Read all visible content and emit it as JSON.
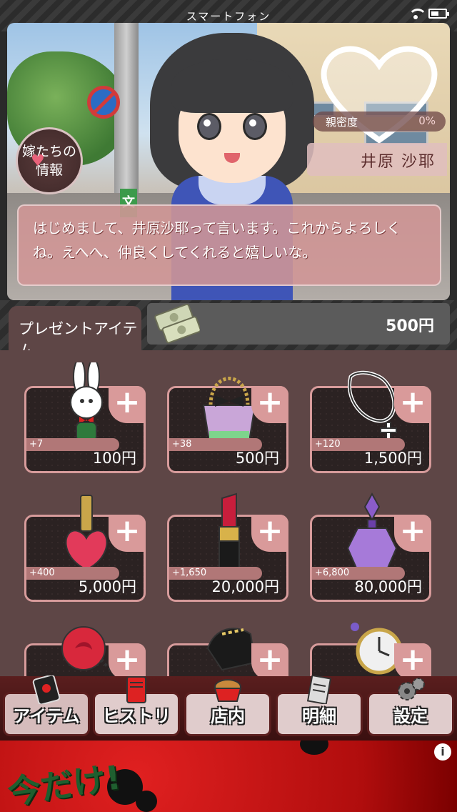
{
  "status_bar": {
    "title": "スマートフォン"
  },
  "scene": {
    "affection_label": "親密度",
    "affection_value": "0%",
    "character_name": "井原 沙耶",
    "info_button": {
      "line1": "嫁たちの",
      "line2": "情報"
    },
    "school_sign": "文",
    "dialog": "はじめまして、井原沙耶って言います。これからよろしくね。えへへ、仲良くしてくれると嬉しいな。"
  },
  "present": {
    "tab_label": "プレゼントアイテム",
    "money": "500円"
  },
  "items": [
    {
      "icon": "bunny-doll-icon",
      "affinity": "+7",
      "affinity_level": 0.55,
      "price": "100円"
    },
    {
      "icon": "handbag-icon",
      "affinity": "+38",
      "affinity_level": 0.55,
      "price": "500円"
    },
    {
      "icon": "necklace-icon",
      "affinity": "+120",
      "affinity_level": 0.55,
      "price": "1,500円"
    },
    {
      "icon": "nail-polish-icon",
      "affinity": "+400",
      "affinity_level": 0.55,
      "price": "5,000円"
    },
    {
      "icon": "lipstick-icon",
      "affinity": "+1,650",
      "affinity_level": 0.55,
      "price": "20,000円"
    },
    {
      "icon": "perfume-icon",
      "affinity": "+6,800",
      "affinity_level": 0.55,
      "price": "80,000円"
    },
    {
      "icon": "rose-icon",
      "affinity": "",
      "affinity_level": 0,
      "price": ""
    },
    {
      "icon": "shoe-icon",
      "affinity": "",
      "affinity_level": 0,
      "price": ""
    },
    {
      "icon": "pocket-watch-icon",
      "affinity": "",
      "affinity_level": 0,
      "price": ""
    }
  ],
  "nav": {
    "item": "アイテム",
    "history": "ヒストリー",
    "shop": "店内",
    "details": "明細",
    "settings": "設定"
  },
  "ad": {
    "text": "今だけ!",
    "info": "i"
  },
  "colors": {
    "accent_pink": "#d99a9a",
    "panel_brown": "#5e4646",
    "nav_red": "#5a1e1e"
  }
}
